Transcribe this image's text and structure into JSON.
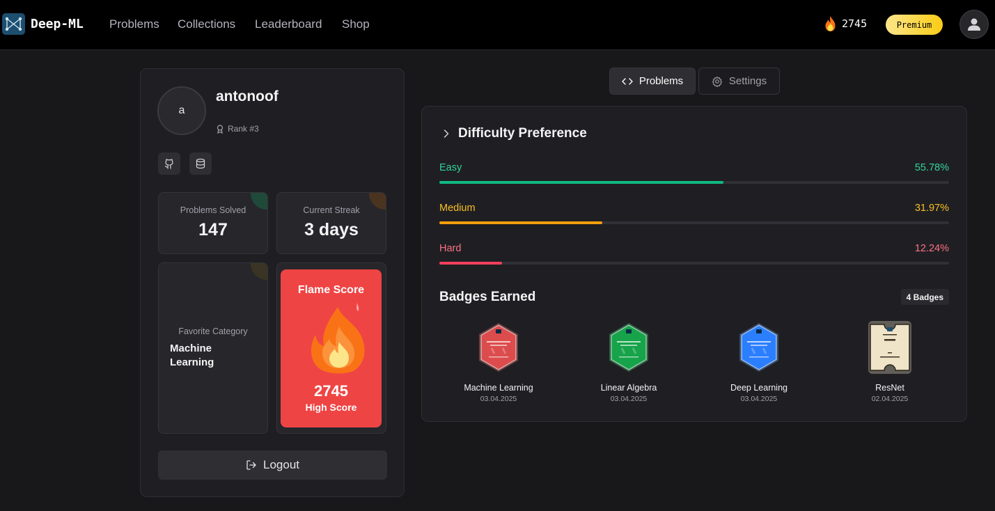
{
  "nav": {
    "brand": "Deep-ML",
    "links": [
      "Problems",
      "Collections",
      "Leaderboard",
      "Shop"
    ],
    "flame_count": "2745",
    "premium_label": "Premium"
  },
  "profile": {
    "avatar_initial": "a",
    "username": "antonoof",
    "rank": "Rank #3",
    "stats": {
      "solved_label": "Problems Solved",
      "solved_value": "147",
      "streak_label": "Current Streak",
      "streak_value": "3 days",
      "favorite_label": "Favorite Category",
      "favorite_value": "Machine Learning"
    },
    "flame": {
      "title": "Flame Score",
      "score": "2745",
      "subtitle": "High Score"
    },
    "logout_label": "Logout"
  },
  "tabs": [
    {
      "label": "Problems",
      "active": true
    },
    {
      "label": "Settings",
      "active": false
    }
  ],
  "difficulty": {
    "title": "Difficulty Preference",
    "rows": [
      {
        "label": "Easy",
        "percent_text": "55.78%",
        "fraction": 0.5578,
        "color": "#34d399",
        "bar_color": "#10b981"
      },
      {
        "label": "Medium",
        "percent_text": "31.97%",
        "fraction": 0.3197,
        "color": "#fbbf24",
        "bar_color": "#f59e0b"
      },
      {
        "label": "Hard",
        "percent_text": "12.24%",
        "fraction": 0.1224,
        "color": "#fb7185",
        "bar_color": "#f43f5e"
      }
    ]
  },
  "badges": {
    "title": "Badges Earned",
    "count_label": "4 Badges",
    "items": [
      {
        "name": "Machine Learning",
        "date": "03.04.2025",
        "color": "#dc4c4c",
        "glow": "#ff7b7b",
        "shape": "hex"
      },
      {
        "name": "Linear Algebra",
        "date": "03.04.2025",
        "color": "#16a34a",
        "glow": "#4ade80",
        "shape": "hex"
      },
      {
        "name": "Deep Learning",
        "date": "03.04.2025",
        "color": "#2b7fff",
        "glow": "#60a5fa",
        "shape": "hex"
      },
      {
        "name": "ResNet",
        "date": "02.04.2025",
        "color": "#efe3c8",
        "glow": "#fff3d6",
        "shape": "ticket"
      }
    ]
  }
}
